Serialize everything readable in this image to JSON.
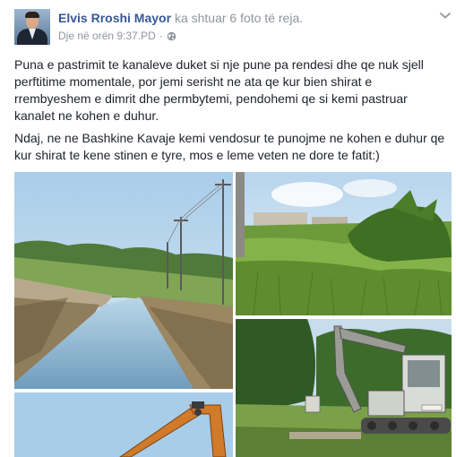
{
  "post": {
    "author": "Elvis Rroshi Mayor",
    "action": "ka shtuar 6 foto të reja.",
    "timestamp": "Dje në orën 9:37.PD",
    "separator": "·",
    "privacy_icon": "globe-icon",
    "menu_icon": "chevron-down-icon",
    "paragraphs": [
      "Puna e pastrimit te kanaleve duket si nje pune pa rendesi dhe qe nuk sjell perftitime momentale, por jemi serisht ne ata qe kur bien shirat e rrembyeshem e dimrit dhe permbytemi, pendohemi qe si kemi pastruar kanalet ne kohen e duhur.",
      "Ndaj, ne ne Bashkine Kavaje kemi vendosur te punojme ne kohen e duhur qe kur shirat te kene stinen e tyre, mos e leme veten ne dore te fatit:)"
    ]
  },
  "colors": {
    "author": "#365899",
    "meta": "#90949c",
    "text": "#1d2129"
  }
}
